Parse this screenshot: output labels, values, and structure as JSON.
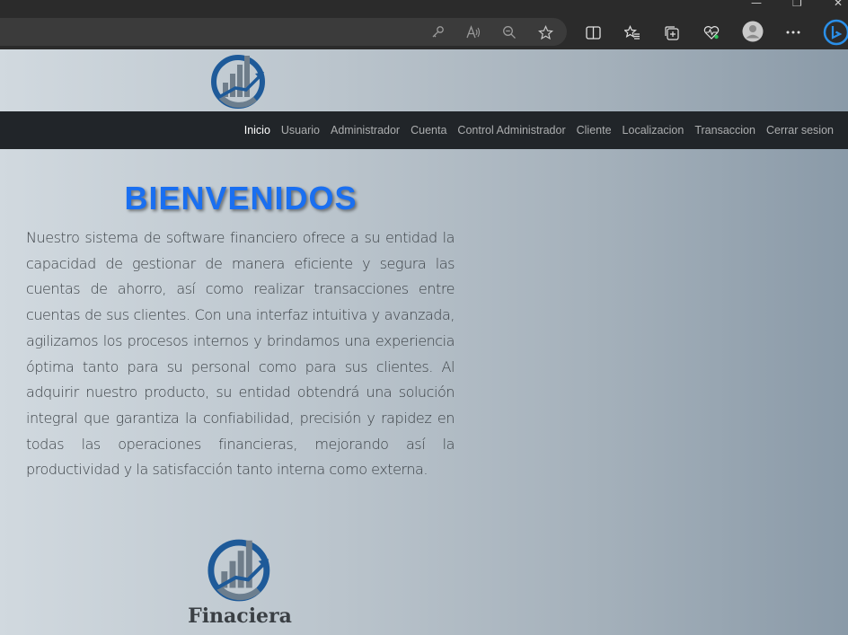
{
  "browser": {
    "icons": [
      "key-icon",
      "read-aloud-icon",
      "zoom-out-icon",
      "favorite-star-icon",
      "split-screen-icon",
      "favorites-icon",
      "collections-icon",
      "performance-icon",
      "profile-icon",
      "more-icon",
      "bing-icon"
    ]
  },
  "logo": {
    "icon": "finance-chart-logo"
  },
  "nav": {
    "items": [
      {
        "label": "Inicio",
        "active": true
      },
      {
        "label": "Usuario"
      },
      {
        "label": "Administrador"
      },
      {
        "label": "Cuenta"
      },
      {
        "label": "Control Administrador"
      },
      {
        "label": "Cliente"
      },
      {
        "label": "Localizacion"
      },
      {
        "label": "Transaccion"
      },
      {
        "label": "Cerrar sesion"
      }
    ]
  },
  "main": {
    "heading": "BIENVENIDOS",
    "paragraph": "Nuestro sistema de software financiero ofrece a su entidad la capacidad de gestionar de manera eficiente y segura las cuentas de ahorro, así como realizar transacciones entre cuentas de sus clientes. Con una interfaz intuitiva y avanzada, agilizamos los procesos internos y brindamos una experiencia óptima tanto para su personal como para sus clientes. Al adquirir nuestro producto, su entidad obtendrá una solución integral que garantiza la confiabilidad, precisión y rapidez en todas las operaciones financieras, mejorando así la productividad y la satisfacción tanto interna como externa."
  },
  "footer_brand": {
    "name": "Finaciera"
  },
  "colors": {
    "accent": "#1a6ff0",
    "navbar": "#212529"
  }
}
